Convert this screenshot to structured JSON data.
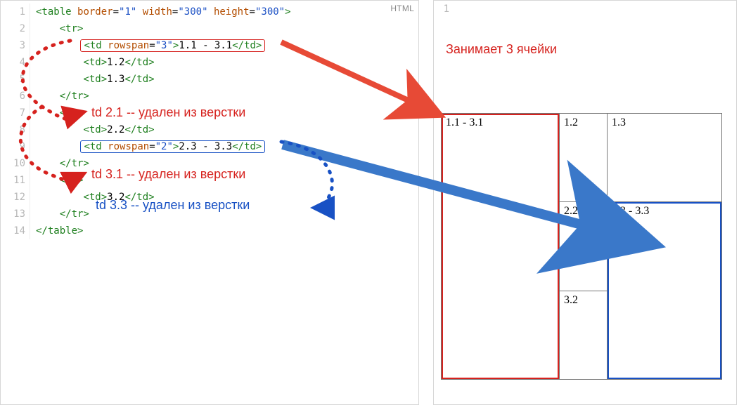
{
  "lang_badge": "HTML",
  "annotations": {
    "takes3cells": "Занимает 3 ячейки",
    "td21_removed": "td 2.1 -- удален из верстки",
    "td31_removed": "td 3.1 -- удален из верстки",
    "td33_removed": "td 3.3 -- удален из верстки"
  },
  "code_lines": {
    "l1": "<table border=\"1\" width=\"300\" height=\"300\">",
    "l2": "    <tr>",
    "l3_pre": "        ",
    "l3_tag_open": "<td rowspan=\"3\">",
    "l3_text": "1.1 - 3.1",
    "l3_tag_close": "</td>",
    "l4": "        <td>1.2</td>",
    "l5": "        <td>1.3</td>",
    "l6": "    </tr>",
    "l7": "    <tr>",
    "l8": "        <td>2.2</td>",
    "l9_pre": "        ",
    "l9_tag_open": "<td rowspan=\"2\">",
    "l9_text": "2.3 - 3.3",
    "l9_tag_close": "</td>",
    "l10": "    </tr>",
    "l11": "    <tr>",
    "l12": "        <td>3.2</td>",
    "l13": "    </tr>",
    "l14": "</table>"
  },
  "line_numbers": [
    "1",
    "2",
    "3",
    "4",
    "5",
    "6",
    "7",
    "8",
    "9",
    "10",
    "11",
    "12",
    "13",
    "14"
  ],
  "out_line_number": "1",
  "rendered_table": {
    "r1c1": "1.1 - 3.1",
    "r1c2": "1.2",
    "r1c3": "1.3",
    "r2c2": "2.2",
    "r2c3": "2.3 - 3.3",
    "r3c2": "3.2"
  },
  "colors": {
    "red": "#d6221e",
    "blue": "#1851c4",
    "arrow_red": "#e74a36",
    "arrow_blue": "#3a78c9"
  }
}
